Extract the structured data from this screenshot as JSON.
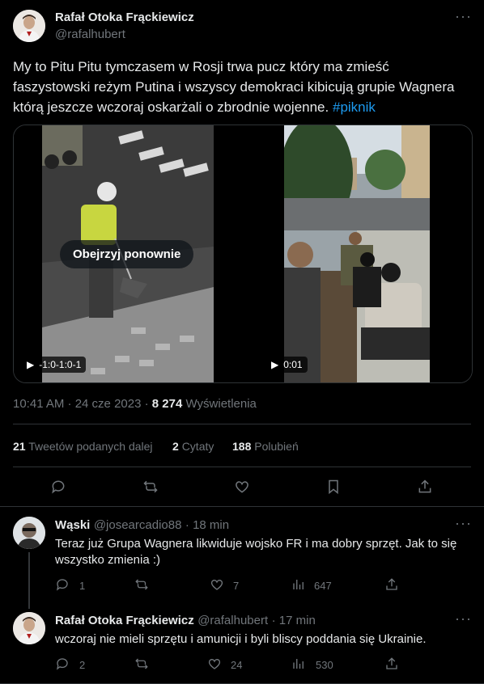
{
  "main_tweet": {
    "author_name": "Rafał Otoka Frąckiewicz",
    "author_handle": "@rafalhubert",
    "more_label": "···",
    "text": "My to Pitu Pitu tymczasem w Rosji trwa pucz który ma zmieść faszystowski reżym Putina i wszyscy demokraci kibicują grupie Wagnera którą jeszcze wczoraj oskarżali o zbrodnie wojenne.",
    "hashtag": "#piknik",
    "media": {
      "left_video_time": "-1:0-1:0-1",
      "left_video_overlay": "Obejrzyj ponownie",
      "right_video_time": "0:01"
    },
    "timestamp": "10:41 AM · 24 cze 2023 ·",
    "views_count": "8 274",
    "views_label": "Wyświetlenia",
    "retweets_count": "21",
    "retweets_label": "Tweetów podanych dalej",
    "quotes_count": "2",
    "quotes_label": "Cytaty",
    "likes_count": "188",
    "likes_label": "Polubień"
  },
  "replies": [
    {
      "author_name": "Wąski",
      "author_handle": "@josearcadio88",
      "time": "· 18 min",
      "text": "Teraz już  Grupa Wagnera likwiduje wojsko FR i ma dobry sprzęt. Jak to się wszystko zmienia :)",
      "reply_count": "1",
      "retweet_count": "",
      "like_count": "7",
      "view_count": "647"
    },
    {
      "author_name": "Rafał Otoka Frąckiewicz",
      "author_handle": "@rafalhubert",
      "time": "· 17 min",
      "text": "wczoraj nie mieli sprzętu i amunicji i byli bliscy poddania się Ukrainie.",
      "reply_count": "2",
      "retweet_count": "",
      "like_count": "24",
      "view_count": "530"
    }
  ],
  "icons": {
    "accent": "#1d9bf0",
    "muted": "#71767b"
  }
}
